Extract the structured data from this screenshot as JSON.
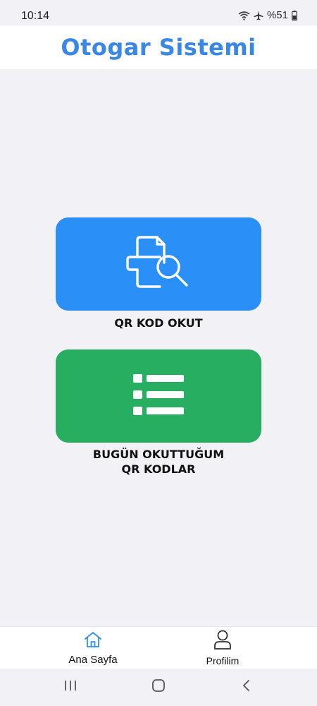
{
  "status_bar": {
    "time": "10:14",
    "battery": "%51",
    "icons": [
      "wifi-icon",
      "airplane-mode-icon",
      "battery-icon"
    ]
  },
  "header": {
    "title": "Otogar Sistemi",
    "color": "#3b87e6"
  },
  "tiles": [
    {
      "label": "QR KOD OKUT",
      "icon": "document-search-icon",
      "color": "#2a8ff7"
    },
    {
      "label_line1": "BUGÜN OKUTTUĞUM",
      "label_line2": "QR KODLAR",
      "icon": "list-icon",
      "color": "#27ae60"
    }
  ],
  "bottom_nav": {
    "items": [
      {
        "label": "Ana Sayfa",
        "icon": "home-icon",
        "active": true
      },
      {
        "label": "Profilim",
        "icon": "user-icon",
        "active": false
      }
    ],
    "active_color": "#2a8ff7"
  },
  "system_nav": {
    "buttons": [
      "recent-apps-icon",
      "home-circle-icon",
      "back-icon"
    ]
  }
}
